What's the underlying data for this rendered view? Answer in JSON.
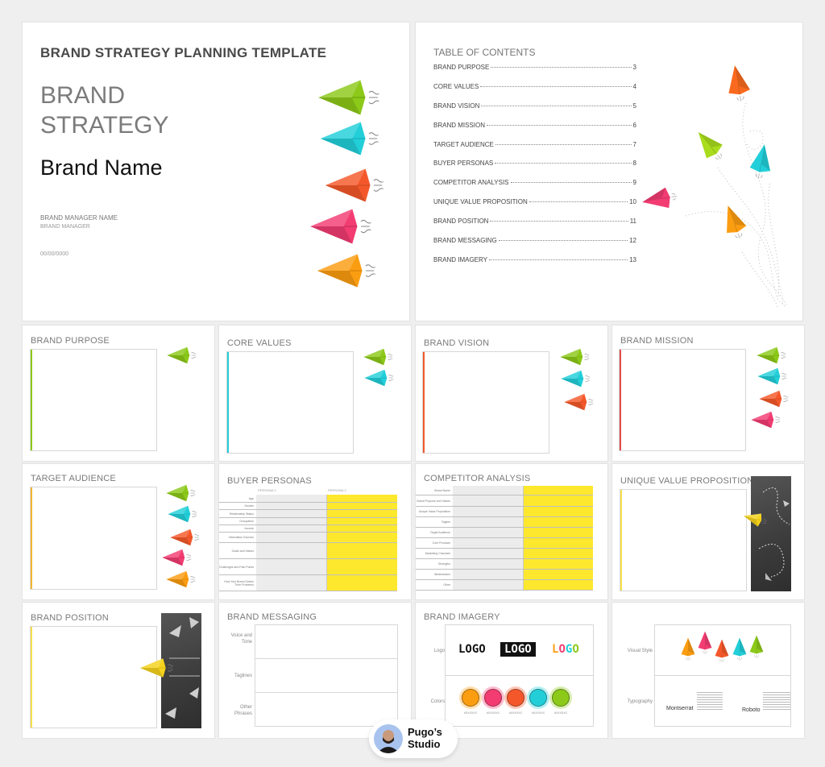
{
  "cover": {
    "heading": "BRAND STRATEGY PLANNING TEMPLATE",
    "title_line1": "BRAND",
    "title_line2": "STRATEGY",
    "brand_name": "Brand Name",
    "manager_name": "BRAND MANAGER NAME",
    "manager_role": "BRAND MANAGER",
    "date": "00/00/0000"
  },
  "toc": {
    "heading": "TABLE OF CONTENTS",
    "items": [
      {
        "label": "BRAND PURPOSE",
        "page": "3"
      },
      {
        "label": "CORE VALUES",
        "page": "4"
      },
      {
        "label": "BRAND VISION",
        "page": "5"
      },
      {
        "label": "BRAND MISSION",
        "page": "6"
      },
      {
        "label": "TARGET AUDIENCE",
        "page": "7"
      },
      {
        "label": "BUYER PERSONAS",
        "page": "8"
      },
      {
        "label": "COMPETITOR ANALYSIS",
        "page": "9"
      },
      {
        "label": "UNIQUE VALUE PROPOSITION",
        "page": "10"
      },
      {
        "label": "BRAND POSITION",
        "page": "11"
      },
      {
        "label": "BRAND MESSAGING",
        "page": "12"
      },
      {
        "label": "BRAND IMAGERY",
        "page": "13"
      }
    ]
  },
  "colors": {
    "green": "#8cc919",
    "cyan": "#22cfd9",
    "red_orange": "#f4582a",
    "pink": "#f23c72",
    "orange": "#fb9d11",
    "yellow": "#fee82d"
  },
  "slides": {
    "brand_purpose": {
      "title": "BRAND PURPOSE"
    },
    "core_values": {
      "title": "CORE VALUES"
    },
    "brand_vision": {
      "title": "BRAND VISION"
    },
    "brand_mission": {
      "title": "BRAND MISSION"
    },
    "target_audience": {
      "title": "TARGET AUDIENCE"
    },
    "buyer_personas": {
      "title": "BUYER PERSONAS",
      "columns": [
        "PERSONA 1",
        "PERSONA 2"
      ],
      "rows": [
        "Age",
        "Gender",
        "Relationship Status",
        "Occupation",
        "Income",
        "Information Sources",
        "Goals and Values",
        "Challenges and Pain Points",
        "How Your Brand Solves Their Problems"
      ]
    },
    "competitor_analysis": {
      "title": "COMPETITOR ANALYSIS",
      "rows": [
        "Brand Name",
        "Brand Purpose and Values",
        "Unique Value Proposition",
        "Tagline",
        "Target Audience",
        "Core Products",
        "Marketing Channels",
        "Strengths",
        "Weaknesses",
        "Other"
      ]
    },
    "unique_value_proposition": {
      "title": "UNIQUE VALUE PROPOSITION"
    },
    "brand_position": {
      "title": "BRAND POSITION"
    },
    "brand_messaging": {
      "title": "BRAND MESSAGING",
      "rows": [
        "Voice and Tone",
        "Taglines",
        "Other Phrases"
      ]
    },
    "brand_imagery": {
      "title": "BRAND IMAGERY",
      "rows": [
        "Logo",
        "Colors"
      ],
      "logo_samples": [
        "LOGO",
        "LOGO",
        "LOGO"
      ],
      "color_codes": [
        "#XXXXXX",
        "#XXXXXX",
        "#XXXXXX",
        "#XXXXXX",
        "#XXXXXX"
      ]
    },
    "brand_imagery_2": {
      "rows": [
        "Visual Style",
        "Typography"
      ],
      "fonts": [
        "Montserrat",
        "Roboto"
      ]
    }
  },
  "badge": {
    "line1": "Pugo’s",
    "line2": "Studio"
  }
}
